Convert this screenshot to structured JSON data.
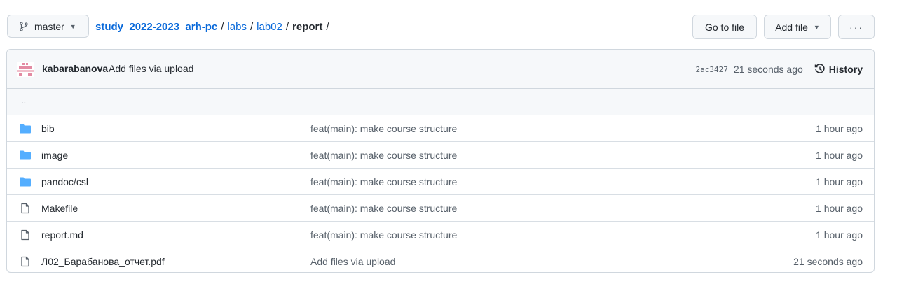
{
  "branch": {
    "label": "master"
  },
  "breadcrumb": {
    "repo": "study_2022-2023_arh-pc",
    "parts": [
      "labs",
      "lab02"
    ],
    "current": "report",
    "trailing_sep": "/"
  },
  "buttons": {
    "goto_file": "Go to file",
    "add_file": "Add file",
    "more": "···"
  },
  "commit": {
    "author": "kabarabanova",
    "message": "Add files via upload",
    "sha": "2ac3427",
    "time": "21 seconds ago",
    "history_label": "History"
  },
  "parent_dir": "..",
  "files": [
    {
      "type": "folder",
      "name": "bib",
      "message": "feat(main): make course structure",
      "age": "1 hour ago"
    },
    {
      "type": "folder",
      "name": "image",
      "message": "feat(main): make course structure",
      "age": "1 hour ago"
    },
    {
      "type": "folder",
      "name": "pandoc/csl",
      "message": "feat(main): make course structure",
      "age": "1 hour ago"
    },
    {
      "type": "file",
      "name": "Makefile",
      "message": "feat(main): make course structure",
      "age": "1 hour ago"
    },
    {
      "type": "file",
      "name": "report.md",
      "message": "feat(main): make course structure",
      "age": "1 hour ago"
    },
    {
      "type": "file",
      "name": "Л02_Барабанова_отчет.pdf",
      "message": "Add files via upload",
      "age": "21 seconds ago"
    }
  ],
  "colors": {
    "folder": "#54aeff",
    "link": "#0969da",
    "muted": "#57606a"
  }
}
